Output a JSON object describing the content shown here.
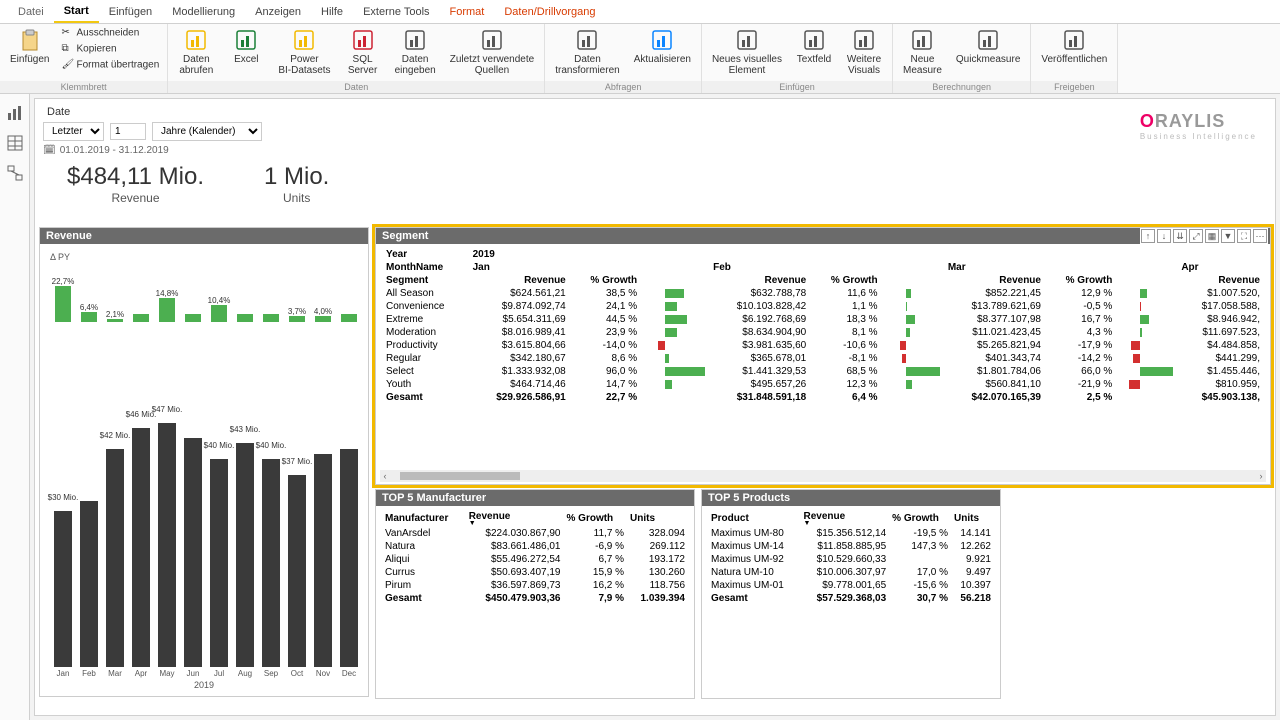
{
  "tabs": {
    "file": "Datei",
    "items": [
      "Start",
      "Einfügen",
      "Modellierung",
      "Anzeigen",
      "Hilfe",
      "Externe Tools",
      "Format",
      "Daten/Drillvorgang"
    ],
    "active": 0,
    "colored": [
      6,
      7
    ]
  },
  "ribbon": {
    "paste": "Einfügen",
    "clip": {
      "cut": "Ausschneiden",
      "copy": "Kopieren",
      "format": "Format übertragen",
      "group": "Klemmbrett"
    },
    "data": {
      "group": "Daten",
      "btns": [
        "Daten\nabrufen",
        "Excel",
        "Power\nBI-Datasets",
        "SQL\nServer",
        "Daten\neingeben",
        "Zuletzt verwendete\nQuellen"
      ]
    },
    "queries": {
      "group": "Abfragen",
      "btns": [
        "Daten\ntransformieren",
        "Aktualisieren"
      ]
    },
    "insert": {
      "group": "Einfügen",
      "btns": [
        "Neues visuelles\nElement",
        "Textfeld",
        "Weitere\nVisuals"
      ]
    },
    "calc": {
      "group": "Berechnungen",
      "btns": [
        "Neue\nMeasure",
        "Quickmeasure"
      ]
    },
    "share": {
      "group": "Freigeben",
      "btns": [
        "Veröffentlichen"
      ]
    }
  },
  "filter": {
    "title": "Date",
    "mode": "Letzter",
    "count": "1",
    "unit": "Jahre (Kalender)",
    "range": "01.01.2019 - 31.12.2019"
  },
  "logo": {
    "name": "RAYLIS",
    "sub": "Business Intelligence"
  },
  "kpi": {
    "rev_val": "$484,11 Mio.",
    "rev_lbl": "Revenue",
    "unit_val": "1 Mio.",
    "unit_lbl": "Units"
  },
  "chart": {
    "title": "Revenue",
    "subtitle": "Δ PY",
    "growth": [
      {
        "l": "22,7%",
        "v": 22.7
      },
      {
        "l": "6,4%",
        "v": 6.4
      },
      {
        "l": "2,1%",
        "v": 2.1
      },
      {
        "l": "14,8%",
        "v": 14.8
      },
      {
        "l": "10,4%",
        "v": 10.4
      },
      {
        "l": "3,7%",
        "v": 3.7
      },
      {
        "l": "4,0%",
        "v": 4.0
      }
    ],
    "growth_positions": [
      0,
      1,
      2,
      4,
      6,
      9,
      10
    ],
    "months": [
      "Jan",
      "Feb",
      "Mar",
      "Apr",
      "May",
      "Jun",
      "Jul",
      "Aug",
      "Sep",
      "Oct",
      "Nov",
      "Dec"
    ],
    "year": "2019",
    "bars": [
      {
        "l": "$30 Mio.",
        "v": 30
      },
      {
        "l": "",
        "v": 32
      },
      {
        "l": "$42 Mio.",
        "v": 42
      },
      {
        "l": "$46 Mio.",
        "v": 46
      },
      {
        "l": "$47 Mio.",
        "v": 47
      },
      {
        "l": "",
        "v": 44
      },
      {
        "l": "$40 Mio.",
        "v": 40
      },
      {
        "l": "$43 Mio.",
        "v": 43
      },
      {
        "l": "$40 Mio.",
        "v": 40
      },
      {
        "l": "$37 Mio.",
        "v": 37
      },
      {
        "l": "",
        "v": 41
      },
      {
        "l": "",
        "v": 42
      }
    ]
  },
  "segment": {
    "title": "Segment",
    "yearLbl": "Year",
    "year": "2019",
    "monthLbl": "MonthName",
    "segLbl": "Segment",
    "cols": [
      "Revenue",
      "% Growth"
    ],
    "months": [
      "Jan",
      "Feb",
      "Mar",
      "Apr"
    ],
    "rows": [
      {
        "s": "All Season",
        "d": [
          [
            "$624.561,21",
            "38,5 %",
            38.5
          ],
          [
            "$632.788,78",
            "11,6 %",
            11.6
          ],
          [
            "$852.221,45",
            "12,9 %",
            12.9
          ],
          [
            "$1.007.520,"
          ]
        ]
      },
      {
        "s": "Convenience",
        "d": [
          [
            "$9.874.092,74",
            "24,1 %",
            24.1
          ],
          [
            "$10.103.828,42",
            "1,1 %",
            1.1
          ],
          [
            "$13.789.621,69",
            "-0,5 %",
            -0.5
          ],
          [
            "$17.058.588,"
          ]
        ]
      },
      {
        "s": "Extreme",
        "d": [
          [
            "$5.654.311,69",
            "44,5 %",
            44.5
          ],
          [
            "$6.192.768,69",
            "18,3 %",
            18.3
          ],
          [
            "$8.377.107,98",
            "16,7 %",
            16.7
          ],
          [
            "$8.946.942,"
          ]
        ]
      },
      {
        "s": "Moderation",
        "d": [
          [
            "$8.016.989,41",
            "23,9 %",
            23.9
          ],
          [
            "$8.634.904,90",
            "8,1 %",
            8.1
          ],
          [
            "$11.021.423,45",
            "4,3 %",
            4.3
          ],
          [
            "$11.697.523,"
          ]
        ]
      },
      {
        "s": "Productivity",
        "d": [
          [
            "$3.615.804,66",
            "-14,0 %",
            -14.0
          ],
          [
            "$3.981.635,60",
            "-10,6 %",
            -10.6
          ],
          [
            "$5.265.821,94",
            "-17,9 %",
            -17.9
          ],
          [
            "$4.484.858,"
          ]
        ]
      },
      {
        "s": "Regular",
        "d": [
          [
            "$342.180,67",
            "8,6 %",
            8.6
          ],
          [
            "$365.678,01",
            "-8,1 %",
            -8.1
          ],
          [
            "$401.343,74",
            "-14,2 %",
            -14.2
          ],
          [
            "$441.299,"
          ]
        ]
      },
      {
        "s": "Select",
        "d": [
          [
            "$1.333.932,08",
            "96,0 %",
            96.0
          ],
          [
            "$1.441.329,53",
            "68,5 %",
            68.5
          ],
          [
            "$1.801.784,06",
            "66,0 %",
            66.0
          ],
          [
            "$1.455.446,"
          ]
        ]
      },
      {
        "s": "Youth",
        "d": [
          [
            "$464.714,46",
            "14,7 %",
            14.7
          ],
          [
            "$495.657,26",
            "12,3 %",
            12.3
          ],
          [
            "$560.841,10",
            "-21,9 %",
            -21.9
          ],
          [
            "$810.959,"
          ]
        ]
      }
    ],
    "total": {
      "s": "Gesamt",
      "d": [
        [
          "$29.926.586,91",
          "22,7 %"
        ],
        [
          "$31.848.591,18",
          "6,4 %"
        ],
        [
          "$42.070.165,39",
          "2,5 %"
        ],
        [
          "$45.903.138,"
        ]
      ]
    }
  },
  "top5m": {
    "title": "TOP 5 Manufacturer",
    "headers": [
      "Manufacturer",
      "Revenue",
      "% Growth",
      "Units"
    ],
    "rows": [
      [
        "VanArsdel",
        "$224.030.867,90",
        "11,7 %",
        "328.094"
      ],
      [
        "Natura",
        "$83.661.486,01",
        "-6,9 %",
        "269.112"
      ],
      [
        "Aliqui",
        "$55.496.272,54",
        "6,7 %",
        "193.172"
      ],
      [
        "Currus",
        "$50.693.407,19",
        "15,9 %",
        "130.260"
      ],
      [
        "Pirum",
        "$36.597.869,73",
        "16,2 %",
        "118.756"
      ]
    ],
    "total": [
      "Gesamt",
      "$450.479.903,36",
      "7,9 %",
      "1.039.394"
    ]
  },
  "top5p": {
    "title": "TOP 5 Products",
    "headers": [
      "Product",
      "Revenue",
      "% Growth",
      "Units"
    ],
    "rows": [
      [
        "Maximus UM-80",
        "$15.356.512,14",
        "-19,5 %",
        "14.141"
      ],
      [
        "Maximus UM-14",
        "$11.858.885,95",
        "147,3 %",
        "12.262"
      ],
      [
        "Maximus UM-92",
        "$10.529.660,33",
        "",
        "9.921"
      ],
      [
        "Natura UM-10",
        "$10.006.307,97",
        "17,0 %",
        "9.497"
      ],
      [
        "Maximus UM-01",
        "$9.778.001,65",
        "-15,6 %",
        "10.397"
      ]
    ],
    "total": [
      "Gesamt",
      "$57.529.368,03",
      "30,7 %",
      "56.218"
    ]
  }
}
